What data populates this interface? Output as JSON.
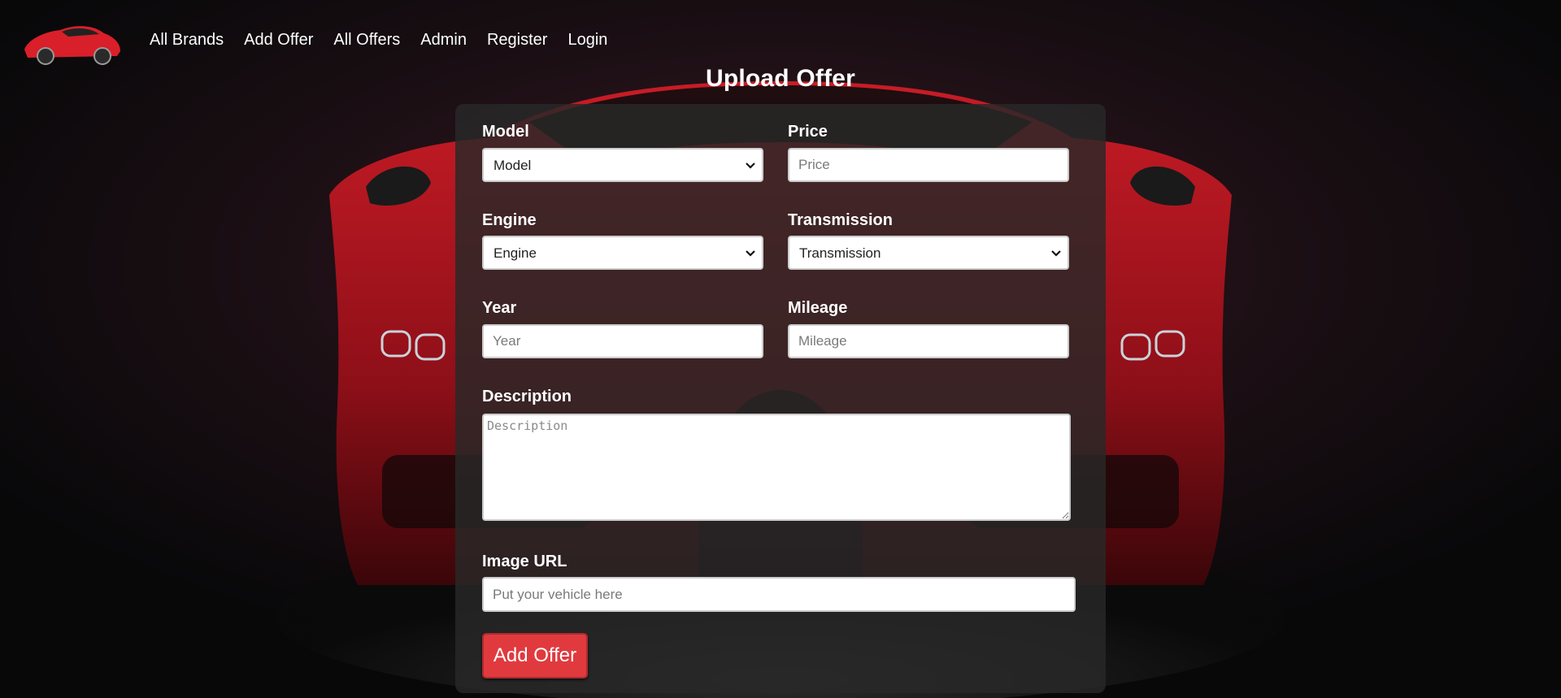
{
  "nav": {
    "links": [
      "All Brands",
      "Add Offer",
      "All Offers",
      "Admin",
      "Register",
      "Login"
    ]
  },
  "page": {
    "title": "Upload Offer"
  },
  "form": {
    "model": {
      "label": "Model",
      "selected": "Model"
    },
    "price": {
      "label": "Price",
      "placeholder": "Price"
    },
    "engine": {
      "label": "Engine",
      "selected": "Engine"
    },
    "transmission": {
      "label": "Transmission",
      "selected": "Transmission"
    },
    "year": {
      "label": "Year",
      "placeholder": "Year"
    },
    "mileage": {
      "label": "Mileage",
      "placeholder": "Mileage"
    },
    "description": {
      "label": "Description",
      "placeholder": "Description"
    },
    "image_url": {
      "label": "Image URL",
      "placeholder": "Put your vehicle here"
    },
    "submit_label": "Add Offer"
  },
  "colors": {
    "accent": "#e03a3e",
    "car_red": "#b3141e",
    "background": "#0b0b0d"
  }
}
